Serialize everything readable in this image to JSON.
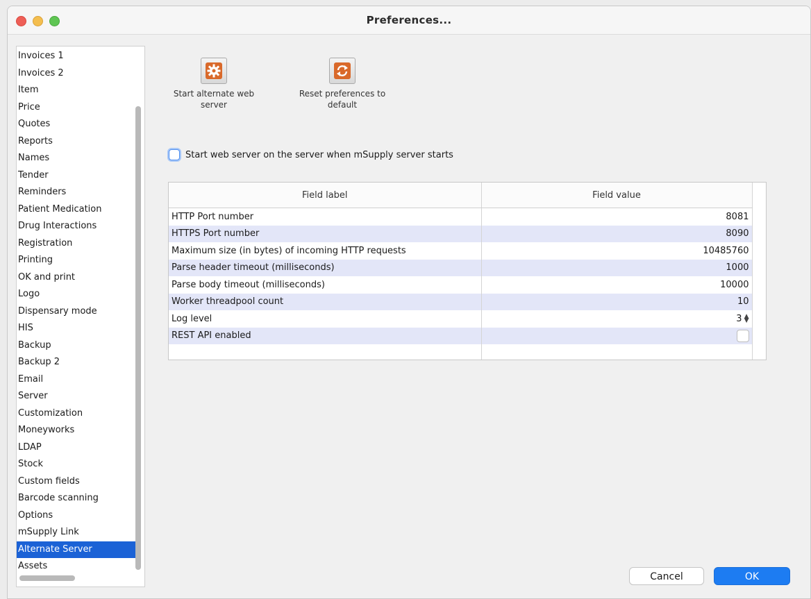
{
  "window": {
    "title": "Preferences..."
  },
  "sidebar": {
    "items": [
      {
        "label": "Invoices 1"
      },
      {
        "label": "Invoices 2"
      },
      {
        "label": "Item"
      },
      {
        "label": "Price"
      },
      {
        "label": "Quotes"
      },
      {
        "label": "Reports"
      },
      {
        "label": "Names"
      },
      {
        "label": "Tender"
      },
      {
        "label": "Reminders"
      },
      {
        "label": "Patient Medication"
      },
      {
        "label": "Drug Interactions"
      },
      {
        "label": "Registration"
      },
      {
        "label": "Printing"
      },
      {
        "label": "OK and print"
      },
      {
        "label": "Logo"
      },
      {
        "label": "Dispensary mode"
      },
      {
        "label": "HIS"
      },
      {
        "label": "Backup"
      },
      {
        "label": "Backup 2"
      },
      {
        "label": "Email"
      },
      {
        "label": "Server"
      },
      {
        "label": "Customization"
      },
      {
        "label": "Moneyworks"
      },
      {
        "label": "LDAP"
      },
      {
        "label": "Stock"
      },
      {
        "label": "Custom fields"
      },
      {
        "label": "Barcode scanning"
      },
      {
        "label": "Options"
      },
      {
        "label": "mSupply Link"
      },
      {
        "label": "Alternate Server",
        "selected": true
      },
      {
        "label": "Assets"
      }
    ]
  },
  "toolbar": {
    "start_server": {
      "line1": "Start alternate web",
      "line2": "server",
      "icon": "gear-icon"
    },
    "reset_prefs": {
      "line1": "Reset preferences to",
      "line2": "default",
      "icon": "reset-icon"
    }
  },
  "checkbox": {
    "label": "Start web server on the server when mSupply server starts",
    "checked": false
  },
  "grid": {
    "columns": [
      "Field label",
      "Field value"
    ],
    "rows": [
      {
        "label": "HTTP Port number",
        "value": "8081"
      },
      {
        "label": "HTTPS Port number",
        "value": "8090"
      },
      {
        "label": "Maximum size (in bytes) of incoming HTTP requests",
        "value": "10485760"
      },
      {
        "label": "Parse header timeout (milliseconds)",
        "value": "1000"
      },
      {
        "label": "Parse body timeout (milliseconds)",
        "value": "10000"
      },
      {
        "label": "Worker threadpool count",
        "value": "10"
      },
      {
        "label": "Log level",
        "value": "3"
      },
      {
        "label": "REST API enabled",
        "value": "",
        "checked": false
      }
    ]
  },
  "footer": {
    "cancel_label": "Cancel",
    "ok_label": "OK"
  },
  "colors": {
    "accent": "#1d7cf2",
    "selection": "#1b62d6",
    "alt_row": "#e3e6f8"
  }
}
